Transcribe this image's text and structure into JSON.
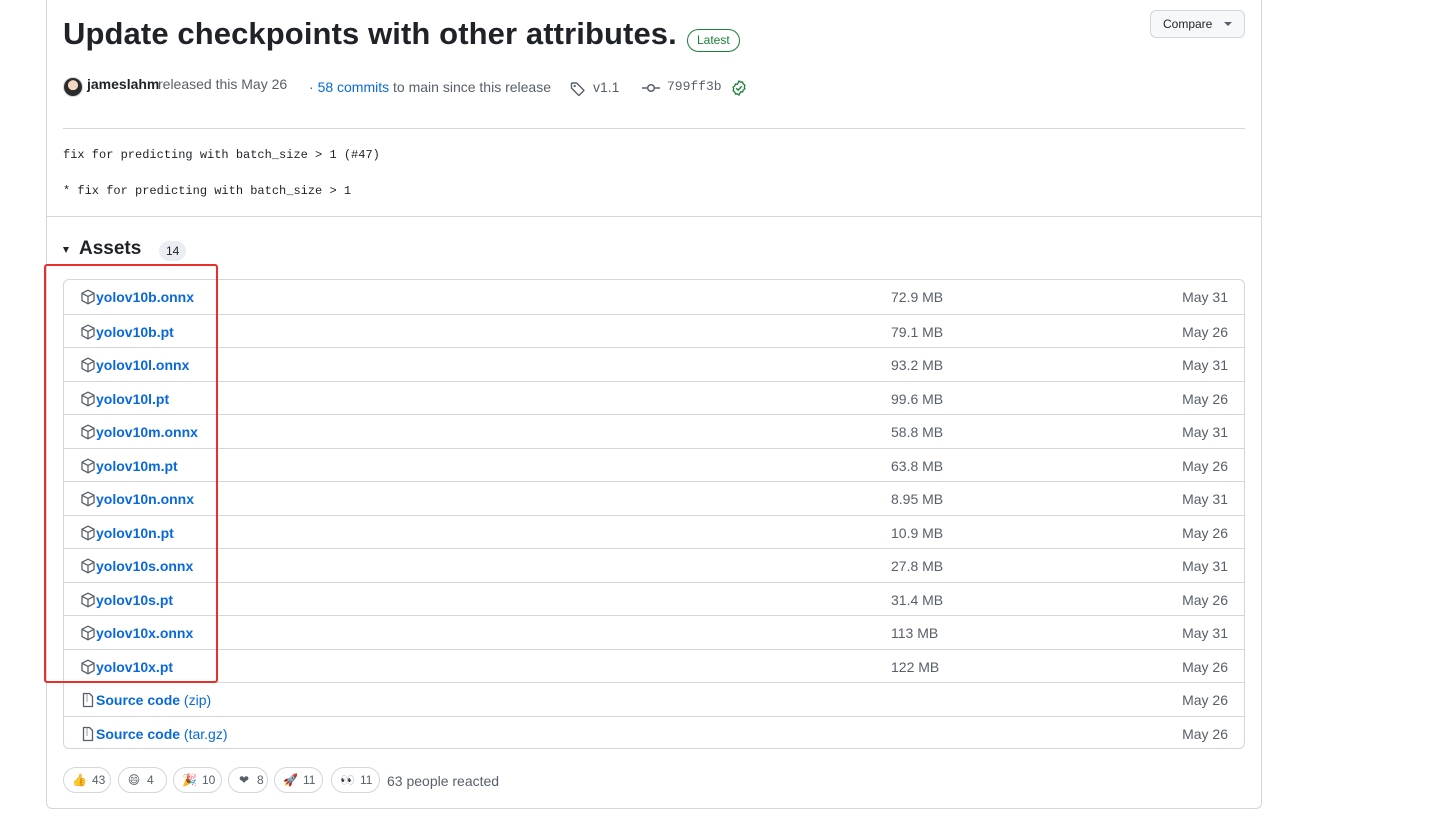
{
  "release": {
    "title": "Update checkpoints with other attributes.",
    "badge": "Latest",
    "compare_label": "Compare",
    "author": "jameslahm",
    "released_text": "released this May 26",
    "commits_prefix": "·",
    "commits_link": "58 commits",
    "commits_suffix": "to main since this release",
    "tag": "v1.1",
    "sha": "799ff3b",
    "notes": [
      "fix for predicting with batch_size > 1 (#47)",
      "* fix for predicting with batch_size > 1"
    ]
  },
  "assets": {
    "title": "Assets",
    "count": "14",
    "rows": [
      {
        "name": "yolov10b.onnx",
        "size": "72.9 MB",
        "date": "May 31"
      },
      {
        "name": "yolov10b.pt",
        "size": "79.1 MB",
        "date": "May 26"
      },
      {
        "name": "yolov10l.onnx",
        "size": "93.2 MB",
        "date": "May 31"
      },
      {
        "name": "yolov10l.pt",
        "size": "99.6 MB",
        "date": "May 26"
      },
      {
        "name": "yolov10m.onnx",
        "size": "58.8 MB",
        "date": "May 31"
      },
      {
        "name": "yolov10m.pt",
        "size": "63.8 MB",
        "date": "May 26"
      },
      {
        "name": "yolov10n.onnx",
        "size": "8.95 MB",
        "date": "May 31"
      },
      {
        "name": "yolov10n.pt",
        "size": "10.9 MB",
        "date": "May 26"
      },
      {
        "name": "yolov10s.onnx",
        "size": "27.8 MB",
        "date": "May 31"
      },
      {
        "name": "yolov10s.pt",
        "size": "31.4 MB",
        "date": "May 26"
      },
      {
        "name": "yolov10x.onnx",
        "size": "113 MB",
        "date": "May 31"
      },
      {
        "name": "yolov10x.pt",
        "size": "122 MB",
        "date": "May 26"
      }
    ],
    "source": [
      {
        "name": "Source code",
        "suffix": "(zip)",
        "date": "May 26"
      },
      {
        "name": "Source code",
        "suffix": "(tar.gz)",
        "date": "May 26"
      }
    ]
  },
  "reactions": {
    "items": [
      {
        "icon": "thumbs-up",
        "emoji": "👍",
        "count": "43"
      },
      {
        "icon": "laugh",
        "emoji": "😄",
        "count": "4"
      },
      {
        "icon": "hooray",
        "emoji": "🎉",
        "count": "10"
      },
      {
        "icon": "heart",
        "emoji": "❤",
        "count": "8"
      },
      {
        "icon": "rocket",
        "emoji": "🚀",
        "count": "11"
      },
      {
        "icon": "eyes",
        "emoji": "👀",
        "count": "11"
      }
    ],
    "summary": "63 people reacted"
  }
}
